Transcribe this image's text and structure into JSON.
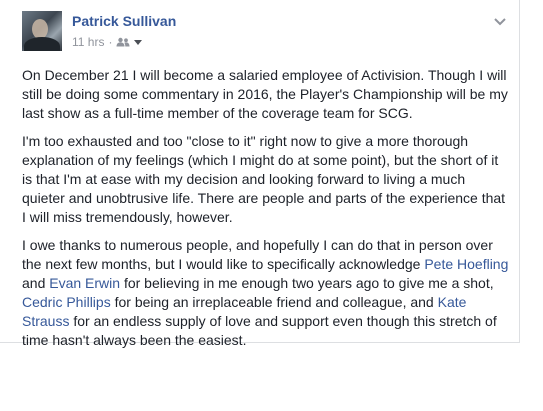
{
  "post": {
    "author": "Patrick Sullivan",
    "time": "11 hrs",
    "separator": "·",
    "audience_icon": "friends-icon",
    "options_icon": "chevron-down-icon",
    "paragraphs": {
      "p1": "On December 21 I will become a salaried employee of Activision. Though I will still be doing some commentary in 2016, the Player's Championship will be my last show as a full-time member of the coverage team for SCG.",
      "p2": "I'm too exhausted and too \"close to it\" right now to give a more thorough explanation of my feelings (which I might do at some point), but the short of it is that I'm at ease with my decision and looking forward to living a much quieter and unobtrusive life. There are people and parts of the experience that I will miss tremendously, however.",
      "p3": {
        "t1": "I owe thanks to numerous people, and hopefully I can do that in person over the next few months, but I would like to specifically acknowledge ",
        "link1": "Pete Hoefling",
        "t2": " and ",
        "link2": "Evan Erwin",
        "t3": " for believing in me enough two years ago to give me a shot, ",
        "link3": "Cedric Phillips",
        "t4": " for being an irreplaceable friend and colleague, and ",
        "link4": "Kate Strauss",
        "t5": " for an endless supply of love and support even though this stretch of time hasn't always been the easiest."
      }
    }
  }
}
